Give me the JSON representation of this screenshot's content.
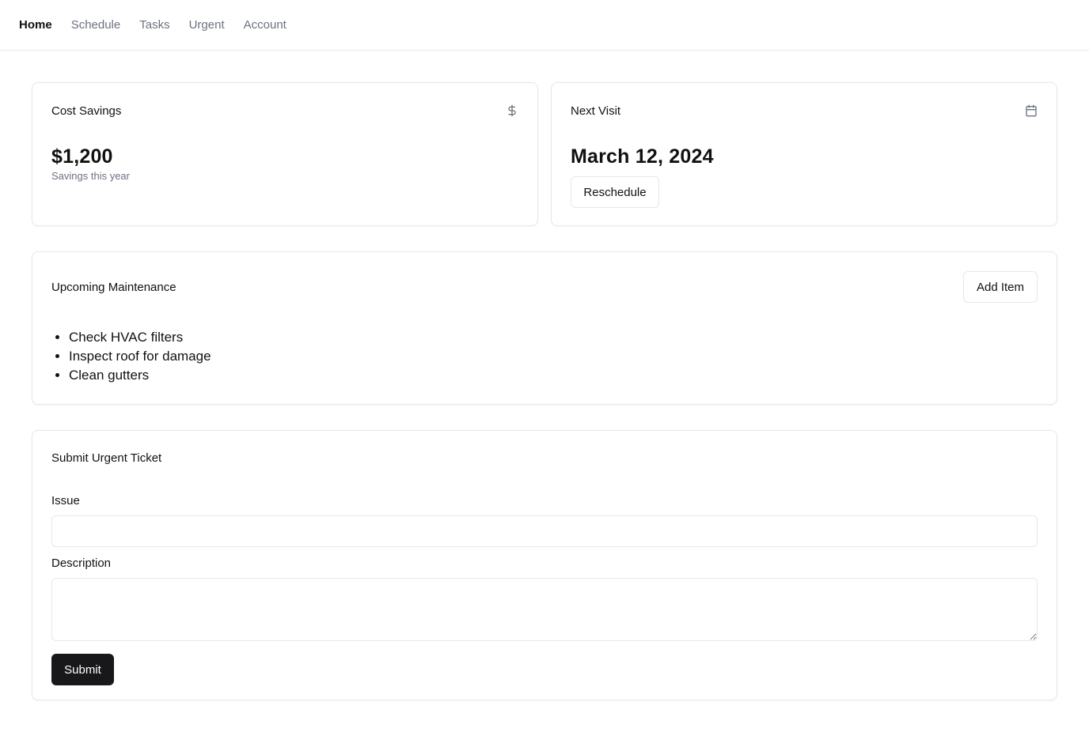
{
  "nav": {
    "items": [
      {
        "label": "Home",
        "active": true
      },
      {
        "label": "Schedule",
        "active": false
      },
      {
        "label": "Tasks",
        "active": false
      },
      {
        "label": "Urgent",
        "active": false
      },
      {
        "label": "Account",
        "active": false
      }
    ]
  },
  "cost_savings": {
    "title": "Cost Savings",
    "icon": "dollar-icon",
    "value": "$1,200",
    "caption": "Savings this year"
  },
  "next_visit": {
    "title": "Next Visit",
    "icon": "calendar-icon",
    "date": "March 12, 2024",
    "reschedule_label": "Reschedule"
  },
  "maintenance": {
    "title": "Upcoming Maintenance",
    "add_label": "Add Item",
    "items": [
      "Check HVAC filters",
      "Inspect roof for damage",
      "Clean gutters"
    ]
  },
  "ticket": {
    "title": "Submit Urgent Ticket",
    "issue_label": "Issue",
    "issue_value": "",
    "description_label": "Description",
    "description_value": "",
    "submit_label": "Submit"
  },
  "colors": {
    "primary_button": "#18181b",
    "muted_text": "#6b7280",
    "border": "#e5e7eb"
  }
}
